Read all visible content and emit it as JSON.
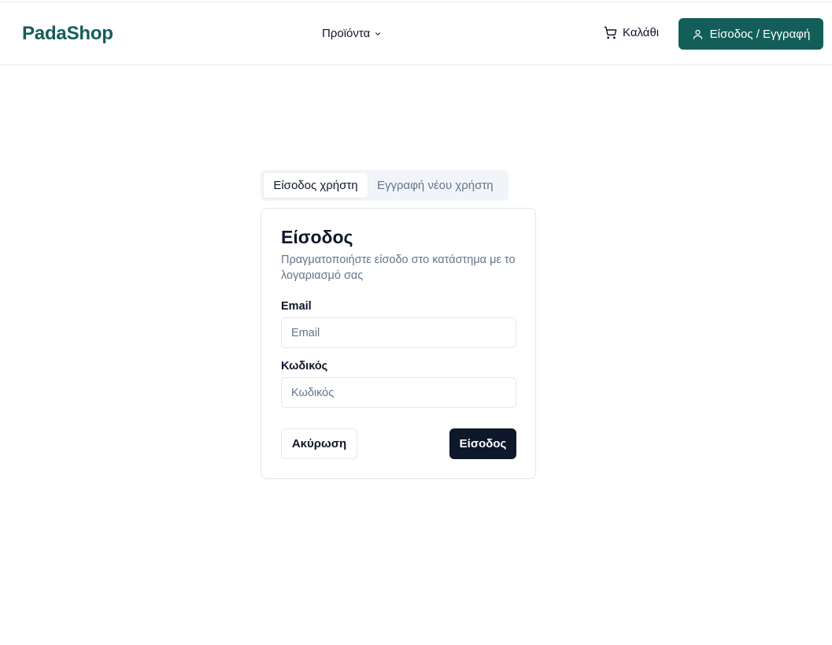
{
  "colors": {
    "brand": "#145e5a",
    "primary_button": "#0f172a",
    "muted_text": "#64748b"
  },
  "header": {
    "logo": "PadaShop",
    "nav": {
      "products_label": "Προϊόντα",
      "products_icon": "chevron-down-icon"
    },
    "cart": {
      "label": "Καλάθι",
      "icon": "cart-icon"
    },
    "auth_button": {
      "label": "Είσοδος / Εγγραφή",
      "icon": "user-icon"
    }
  },
  "tabs": [
    {
      "label": "Είσοδος χρήστη",
      "active": true
    },
    {
      "label": "Εγγραφή νέου χρήστη",
      "active": false
    }
  ],
  "login_card": {
    "title": "Είσοδος",
    "description": "Πραγματοποιήστε είσοδο στο κατάστημα με το λογαριασμό σας",
    "email": {
      "label": "Email",
      "placeholder": "Email",
      "value": ""
    },
    "password": {
      "label": "Κωδικός",
      "placeholder": "Κωδικός",
      "value": ""
    },
    "cancel_label": "Ακύρωση",
    "submit_label": "Είσοδος"
  }
}
